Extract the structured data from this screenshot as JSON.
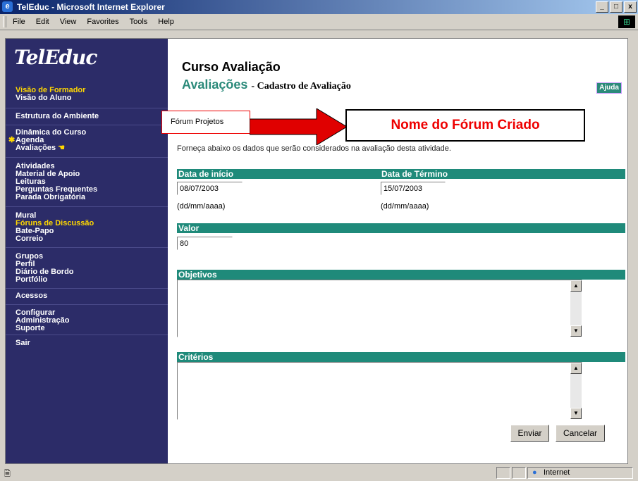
{
  "window": {
    "title": "TelEduc - Microsoft Internet Explorer",
    "controls": {
      "minimize": "_",
      "maximize": "□",
      "close": "x"
    }
  },
  "menu": [
    "File",
    "Edit",
    "View",
    "Favorites",
    "Tools",
    "Help"
  ],
  "sidebar": {
    "logo": "TelEduc",
    "groups": [
      [
        "Visão de Formador",
        "Visão do Aluno"
      ],
      [
        "Estrutura do Ambiente"
      ],
      [
        "Dinâmica do Curso",
        "Agenda",
        "Avaliações"
      ],
      [
        "Atividades",
        "Material de Apoio",
        "Leituras",
        "Perguntas Frequentes",
        "Parada Obrigatória"
      ],
      [
        "Mural",
        "Fóruns de Discussão",
        "Bate-Papo",
        "Correio"
      ],
      [
        "Grupos",
        "Perfil",
        "Diário de Bordo",
        "Portfólio"
      ],
      [
        "Acessos"
      ],
      [
        "Configurar",
        "Administração",
        "Suporte"
      ],
      [
        "Sair"
      ]
    ]
  },
  "course_title": "Curso Avaliação",
  "page": {
    "title": "Avaliações",
    "subtitle": "- Cadastro de Avaliação",
    "help": "Ajuda"
  },
  "forum_name": "Fórum Projetos",
  "callout": "Nome do Fórum Criado",
  "instructions": "Forneça abaixo os dados que serão considerados na avaliação desta atividade.",
  "form": {
    "start_label": "Data de início",
    "start_value": "08/07/2003",
    "start_hint": "(dd/mm/aaaa)",
    "end_label": "Data de Término",
    "end_value": "15/07/2003",
    "end_hint": "(dd/mm/aaaa)",
    "value_label": "Valor",
    "value_value": "80",
    "objectives_label": "Objetivos",
    "criteria_label": "Critérios",
    "submit": "Enviar",
    "cancel": "Cancelar"
  },
  "status": {
    "zone": "Internet"
  },
  "colors": {
    "sidebar": "#2c2c68",
    "accent": "#1f8a7a",
    "highlight": "#ffd700",
    "callout_red": "#e00000"
  }
}
